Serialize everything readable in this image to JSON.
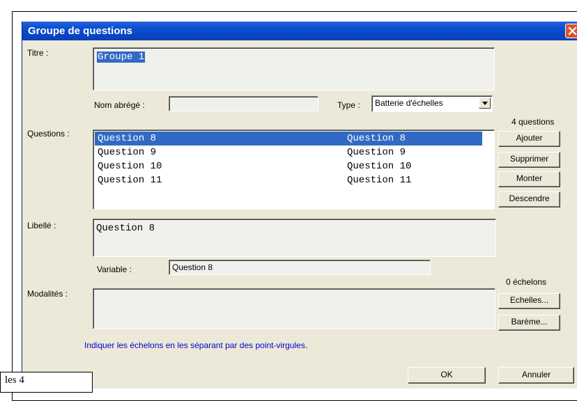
{
  "dialog": {
    "title": "Groupe de questions"
  },
  "titre": {
    "label": "Titre :",
    "value": "Groupe 1"
  },
  "nom_abrege": {
    "label": "Nom abrégé :",
    "value": ""
  },
  "type": {
    "label": "Type :",
    "value": "Batterie d'échelles"
  },
  "questions": {
    "label": "Questions :",
    "count": "4 questions",
    "rows": [
      {
        "col1": "Question 8",
        "col2": "Question 8",
        "selected": true
      },
      {
        "col1": "Question 9",
        "col2": "Question 9",
        "selected": false
      },
      {
        "col1": "Question 10",
        "col2": "Question 10",
        "selected": false
      },
      {
        "col1": "Question 11",
        "col2": "Question 11",
        "selected": false
      }
    ],
    "buttons": {
      "ajouter": "Ajouter",
      "supprimer": "Supprimer",
      "monter": "Monter",
      "descendre": "Descendre"
    }
  },
  "libelle": {
    "label": "Libellé :",
    "value": "Question 8"
  },
  "variable": {
    "label": "Variable :",
    "value": "Question 8"
  },
  "modalites": {
    "label": "Modalités :",
    "count": "0 échelons",
    "value": "",
    "buttons": {
      "echelles": "Echelles...",
      "bareme": "Barème..."
    }
  },
  "hint": "Indiquer les échelons en les séparant par des point-virgules.",
  "footer": {
    "ok": "OK",
    "annuler": "Annuler"
  },
  "note": "les 4",
  "colors": {
    "titlebar": "#0a4ed0",
    "selection": "#316ac5",
    "dialog_bg": "#ece9d8",
    "hint_text": "#0000cc",
    "close_button": "#d8532e"
  }
}
